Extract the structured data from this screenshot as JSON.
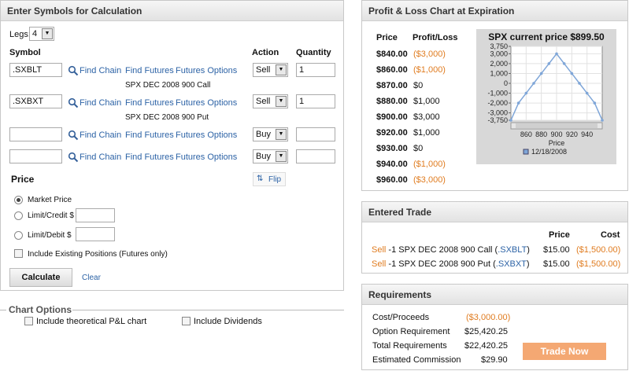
{
  "calc": {
    "title": "Enter Symbols for Calculation",
    "legs_label": "Legs:",
    "legs_value": "4",
    "col_symbol": "Symbol",
    "col_action": "Action",
    "col_quantity": "Quantity",
    "find_chain": "Find Chain",
    "find_futures": "Find Futures",
    "futures_options": "Futures Options",
    "rows": [
      {
        "symbol": ".SXBLT",
        "desc": "SPX DEC 2008 900 Call",
        "action": "Sell",
        "qty": "1"
      },
      {
        "symbol": ".SXBXT",
        "desc": "SPX DEC 2008 900 Put",
        "action": "Sell",
        "qty": "1"
      },
      {
        "symbol": "",
        "desc": "",
        "action": "Buy",
        "qty": ""
      },
      {
        "symbol": "",
        "desc": "",
        "action": "Buy",
        "qty": ""
      }
    ],
    "flip": "Flip",
    "price_label": "Price",
    "market_price": "Market Price",
    "limit_credit": "Limit/Credit $",
    "limit_debit": "Limit/Debit $",
    "include_existing": "Include Existing Positions (Futures only)",
    "calculate": "Calculate",
    "clear": "Clear"
  },
  "chart_options": {
    "title": "Chart Options",
    "theoretical": "Include theoretical P&L chart",
    "dividends": "Include Dividends"
  },
  "pl": {
    "title": "Profit & Loss Chart at Expiration",
    "col_price": "Price",
    "col_pl": "Profit/Loss",
    "rows": [
      {
        "price": "$840.00",
        "pl": "($3,000)",
        "neg": true
      },
      {
        "price": "$860.00",
        "pl": "($1,000)",
        "neg": true
      },
      {
        "price": "$870.00",
        "pl": "$0",
        "neg": false
      },
      {
        "price": "$880.00",
        "pl": "$1,000",
        "neg": false
      },
      {
        "price": "$900.00",
        "pl": "$3,000",
        "neg": false
      },
      {
        "price": "$920.00",
        "pl": "$1,000",
        "neg": false
      },
      {
        "price": "$930.00",
        "pl": "$0",
        "neg": false
      },
      {
        "price": "$940.00",
        "pl": "($1,000)",
        "neg": true
      },
      {
        "price": "$960.00",
        "pl": "($3,000)",
        "neg": true
      }
    ]
  },
  "chart_data": {
    "type": "line",
    "title": "SPX current price $899.50",
    "xlabel": "Price",
    "ylabel": "",
    "x_ticks": [
      "860",
      "880",
      "900",
      "920",
      "940"
    ],
    "y_ticks": [
      "3,750",
      "3,000",
      "2,000",
      "1,000",
      "0",
      "-1,000",
      "-2,000",
      "-3,000",
      "-3,750"
    ],
    "xlim": [
      840,
      960
    ],
    "ylim": [
      -3750,
      3750
    ],
    "series": [
      {
        "name": "12/18/2008",
        "color": "#7fa6d8",
        "x": [
          840,
          850,
          860,
          870,
          880,
          890,
          900,
          910,
          920,
          930,
          940,
          950,
          960
        ],
        "values": [
          -3750,
          -2000,
          -1000,
          0,
          1000,
          2000,
          3000,
          2000,
          1000,
          0,
          -1000,
          -2000,
          -3750
        ]
      }
    ]
  },
  "trade": {
    "title": "Entered Trade",
    "col_price": "Price",
    "col_cost": "Cost",
    "rows": [
      {
        "action": "Sell",
        "desc": " -1 SPX DEC 2008 900 Call (",
        "sym": ".SXBLT",
        "close": ")",
        "price": "$15.00",
        "cost": "($1,500.00)"
      },
      {
        "action": "Sell",
        "desc": " -1 SPX DEC 2008 900 Put (",
        "sym": ".SXBXT",
        "close": ")",
        "price": "$15.00",
        "cost": "($1,500.00)"
      }
    ]
  },
  "req": {
    "title": "Requirements",
    "rows": [
      {
        "label": "Cost/Proceeds",
        "value": "($3,000.00)",
        "orange": true
      },
      {
        "label": "Option Requirement",
        "value": "$25,420.25",
        "orange": false
      },
      {
        "label": "Total Requirements",
        "value": "$22,420.25",
        "orange": false
      },
      {
        "label": "Estimated Commission",
        "value": "$29.90",
        "orange": false
      }
    ],
    "trade_now": "Trade Now"
  }
}
